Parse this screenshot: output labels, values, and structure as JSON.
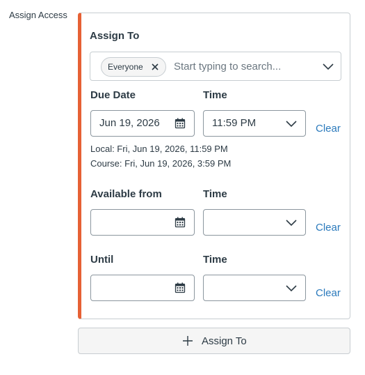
{
  "section": {
    "label": "Assign Access"
  },
  "assign_to": {
    "heading": "Assign To",
    "chip_label": "Everyone",
    "search_placeholder": "Start typing to search..."
  },
  "due": {
    "date_label": "Due Date",
    "time_label": "Time",
    "date_value": "Jun 19, 2026",
    "time_value": "11:59 PM",
    "clear": "Clear",
    "local_note": "Local: Fri, Jun 19, 2026, 11:59 PM",
    "course_note": "Course: Fri, Jun 19, 2026, 3:59 PM"
  },
  "available": {
    "date_label": "Available from",
    "time_label": "Time",
    "date_value": "",
    "time_value": "",
    "clear": "Clear"
  },
  "until": {
    "date_label": "Until",
    "time_label": "Time",
    "date_value": "",
    "time_value": "",
    "clear": "Clear"
  },
  "add_button": {
    "label": "Assign To"
  },
  "colors": {
    "accent": "#e66135",
    "link": "#2b7abc",
    "text": "#2d3b45",
    "border": "#c7cdd1"
  },
  "icons": [
    "close-icon",
    "chevron-down-icon",
    "calendar-icon",
    "plus-icon"
  ]
}
